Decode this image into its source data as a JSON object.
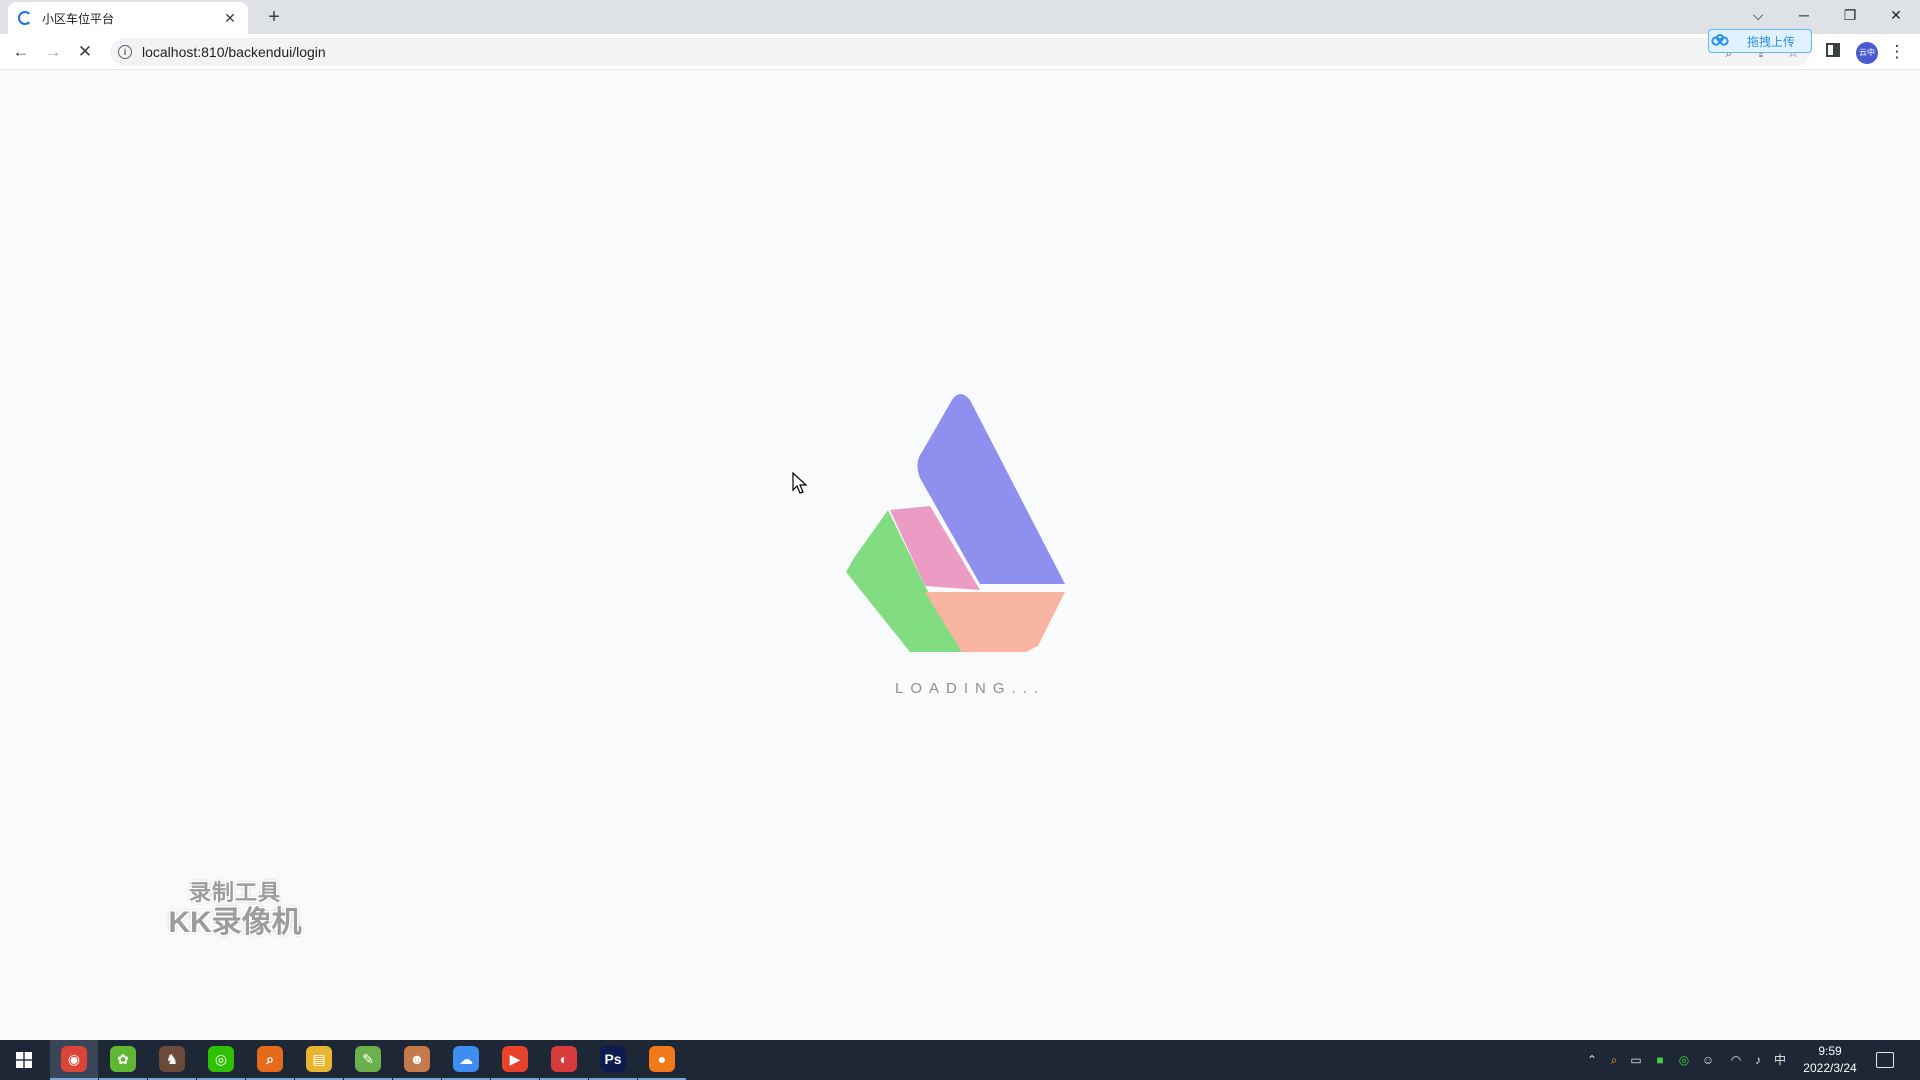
{
  "browser": {
    "tab": {
      "title": "小区车位平台",
      "close_glyph": "✕"
    },
    "new_tab_glyph": "+",
    "window_controls": {
      "tab_search": "⌵",
      "minimize": "─",
      "restore": "❐",
      "close": "✕"
    },
    "nav": {
      "back": "←",
      "forward": "→",
      "stop": "✕"
    },
    "address": "localhost:810/backendui/login",
    "extension_upload_label": "拖拽上传",
    "avatar_text": "云中"
  },
  "page": {
    "loading_text": "LOADING...",
    "logo_colors": {
      "purple": "#8f8ff0",
      "pink": "#ec9cc4",
      "green": "#82dc80",
      "peach": "#f8b6a2"
    }
  },
  "watermark": {
    "line1": "录制工具",
    "line2": "KK录像机"
  },
  "taskbar": {
    "apps": [
      {
        "name": "chrome",
        "color": "#db4437",
        "glyph": "◉",
        "active": true
      },
      {
        "name": "app-green",
        "color": "#5fb732",
        "glyph": "✿",
        "active": false
      },
      {
        "name": "app-game",
        "color": "#6b4a3a",
        "glyph": "♞",
        "active": false
      },
      {
        "name": "wechat",
        "color": "#2dc100",
        "glyph": "◎",
        "active": false
      },
      {
        "name": "search-tool",
        "color": "#e56a1c",
        "glyph": "⌕",
        "active": false
      },
      {
        "name": "file-explorer",
        "color": "#e8b530",
        "glyph": "▤",
        "active": false
      },
      {
        "name": "notepad",
        "color": "#6ab04c",
        "glyph": "✎",
        "active": false
      },
      {
        "name": "app-avatar",
        "color": "#c57a4a",
        "glyph": "☻",
        "active": false
      },
      {
        "name": "baidu-netdisk",
        "color": "#3d8ef0",
        "glyph": "☁",
        "active": false
      },
      {
        "name": "app-red",
        "color": "#e8412c",
        "glyph": "▶",
        "active": false
      },
      {
        "name": "app-recorder",
        "color": "#d83b3b",
        "glyph": "◐",
        "active": false
      },
      {
        "name": "photoshop",
        "color": "#0b1d4f",
        "glyph": "Ps",
        "active": false
      },
      {
        "name": "app-orange",
        "color": "#f07a1a",
        "glyph": "●",
        "active": false
      }
    ],
    "tray": {
      "input_method": "中",
      "time": "9:59",
      "date": "2022/3/24"
    }
  }
}
